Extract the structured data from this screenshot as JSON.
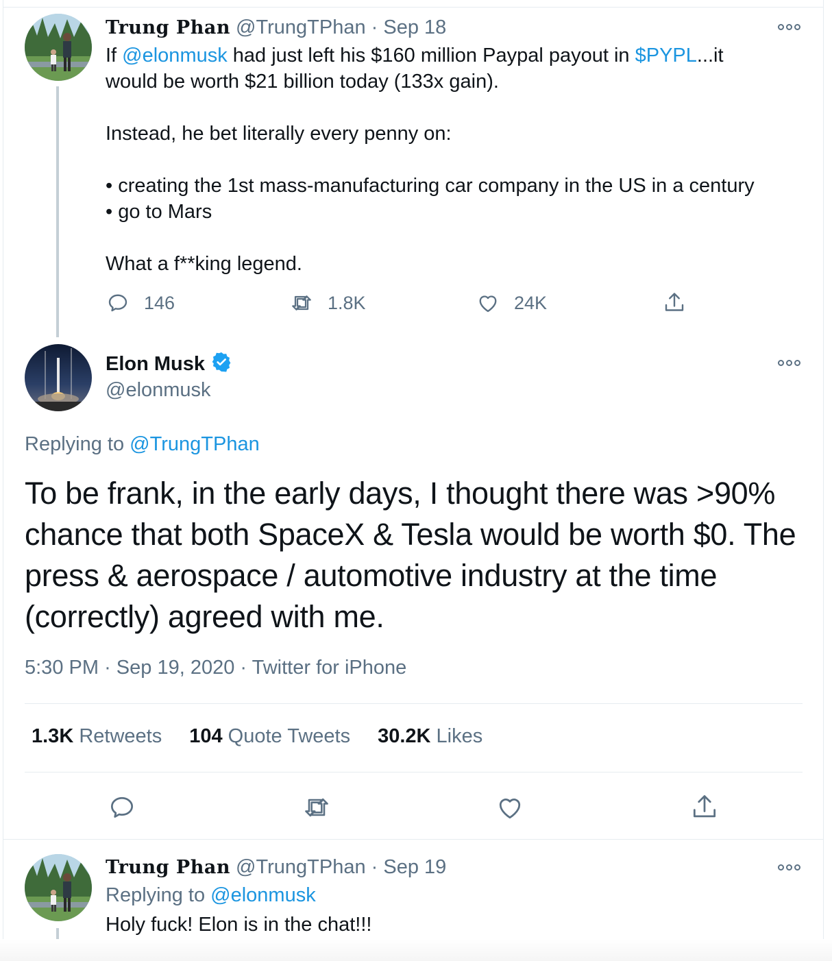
{
  "colors": {
    "link": "#1b95e0",
    "secondary_text": "#5b7083",
    "primary_text": "#0f1419",
    "border": "#e6ecf0",
    "verified": "#1da1f2"
  },
  "tweet1": {
    "display_name": "Trung Phan",
    "handle": "@TrungTPhan",
    "separator": "·",
    "date": "Sep 18",
    "more_icon": "more-icon",
    "line1_prefix": "If ",
    "line1_mention": "@elonmusk",
    "line1_middle": " had just left his $160 million Paypal payout in ",
    "line1_cashtag": "$PYPL",
    "line1_suffix": "...it",
    "line2": "would be worth $21 billion today (133x gain).",
    "line3": "Instead, he bet literally every penny on:",
    "line4": "• creating the 1st mass-manufacturing car company in the US in a century",
    "line5": "• go to Mars",
    "line6": "What a f**king legend.",
    "replies": "146",
    "retweets": "1.8K",
    "likes": "24K"
  },
  "tweet2": {
    "display_name": "Elon Musk",
    "handle": "@elonmusk",
    "verified_icon": "verified-badge-icon",
    "replying_label": "Replying to ",
    "replying_handle": "@TrungTPhan",
    "text_lines": [
      "To be frank, in the early days, I thought there was >90%",
      "chance that both SpaceX & Tesla would be worth $0. The",
      "press & aerospace / automotive industry at the time",
      "(correctly) agreed with me."
    ],
    "time": "5:30 PM",
    "separator": "·",
    "date": "Sep 19, 2020",
    "source": "Twitter for iPhone",
    "retweets_count": "1.3K",
    "retweets_label": "Retweets",
    "quote_count": "104",
    "quote_label": "Quote Tweets",
    "likes_count": "30.2K",
    "likes_label": "Likes"
  },
  "tweet3": {
    "display_name": "Trung Phan",
    "handle": "@TrungTPhan",
    "separator": "·",
    "date": "Sep 19",
    "replying_label": "Replying to ",
    "replying_handle": "@elonmusk",
    "text": "Holy fuck! Elon is in the chat!!!"
  }
}
